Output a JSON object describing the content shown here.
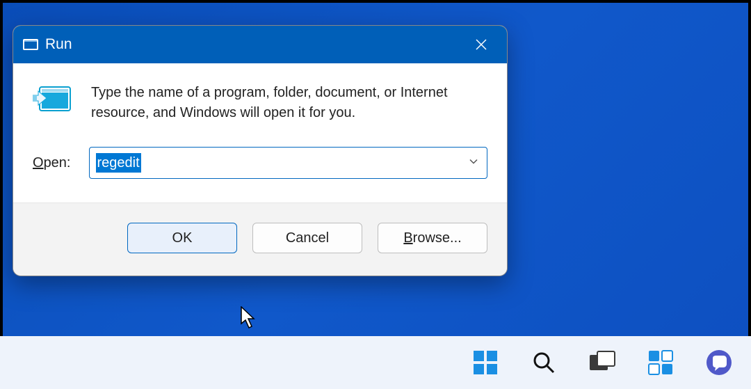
{
  "dialog": {
    "title": "Run",
    "description": "Type the name of a program, folder, document, or Internet resource, and Windows will open it for you.",
    "open_label_underline": "O",
    "open_label_rest": "pen:",
    "input_value": "regedit",
    "buttons": {
      "ok": "OK",
      "cancel": "Cancel",
      "browse_underline": "B",
      "browse_rest": "rowse..."
    }
  },
  "taskbar": {
    "items": [
      "start",
      "search",
      "task-view",
      "widgets",
      "chat"
    ]
  }
}
